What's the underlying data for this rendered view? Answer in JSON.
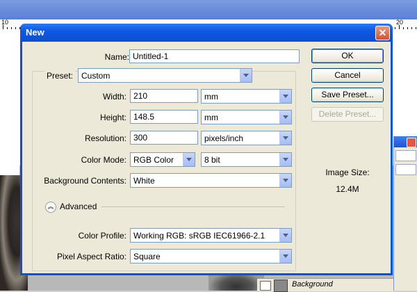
{
  "ruler": {
    "left_num": "10",
    "right_num": "20"
  },
  "dialog": {
    "title": "New",
    "name_label": "Name:",
    "name_value": "Untitled-1",
    "preset_label": "Preset:",
    "preset_value": "Custom",
    "width_label": "Width:",
    "width_value": "210",
    "width_unit": "mm",
    "height_label": "Height:",
    "height_value": "148.5",
    "height_unit": "mm",
    "resolution_label": "Resolution:",
    "resolution_value": "300",
    "resolution_unit": "pixels/inch",
    "color_mode_label": "Color Mode:",
    "color_mode_value": "RGB Color",
    "bit_depth_value": "8 bit",
    "background_label": "Background Contents:",
    "background_value": "White",
    "advanced_label": "Advanced",
    "color_profile_label": "Color Profile:",
    "color_profile_value": "Working RGB:  sRGB IEC61966-2.1",
    "pixel_aspect_label": "Pixel Aspect Ratio:",
    "pixel_aspect_value": "Square",
    "image_size_label": "Image Size:",
    "image_size_value": "12.4M",
    "buttons": {
      "ok": "OK",
      "cancel": "Cancel",
      "save_preset": "Save Preset...",
      "delete_preset": "Delete Preset..."
    }
  },
  "layers": {
    "layer_name": "Background"
  },
  "colors": {
    "title_bar": "#0b4fd2",
    "dialog_bg": "#ece9d8",
    "close": "#d4502f"
  }
}
